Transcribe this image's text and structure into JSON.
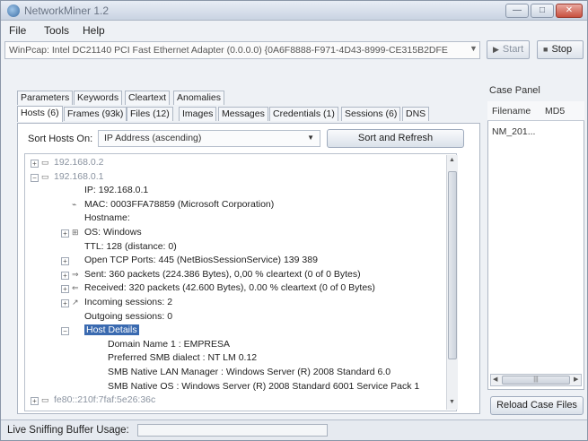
{
  "window": {
    "title": "NetworkMiner 1.2",
    "buttons": {
      "minimize": "—",
      "maximize": "□",
      "close": "✕"
    }
  },
  "menu": [
    "File",
    "Tools",
    "Help"
  ],
  "toolbar": {
    "interface": "WinPcap: Intel DC21140 PCI Fast Ethernet Adapter (0.0.0.0) {0A6F8888-F971-4D43-8999-CE315B2DFE",
    "start_label": "Start",
    "stop_label": "Stop"
  },
  "tabs": {
    "row1": [
      "Parameters",
      "Keywords",
      "Cleartext",
      "Anomalies"
    ],
    "row2": [
      "Hosts (6)",
      "Frames (93k)",
      "Files (12)",
      "Images",
      "Messages",
      "Credentials (1)",
      "Sessions (6)",
      "DNS"
    ],
    "active": "Hosts (6)"
  },
  "sort": {
    "label": "Sort Hosts On:",
    "selected": "IP Address (ascending)",
    "button": "Sort and Refresh"
  },
  "tree": [
    {
      "text": "192.168.0.2",
      "level": 0,
      "expander": "+",
      "icon": "host",
      "dim": true
    },
    {
      "text": "192.168.0.1",
      "level": 0,
      "expander": "−",
      "icon": "host",
      "dim": true
    },
    {
      "text": "IP: 192.168.0.1",
      "level": 1,
      "expander": "",
      "icon": ""
    },
    {
      "text": "MAC: 0003FFA78859 (Microsoft Corporation)",
      "level": 1,
      "expander": "",
      "icon": "nic"
    },
    {
      "text": "Hostname:",
      "level": 1,
      "expander": "",
      "icon": ""
    },
    {
      "text": "OS: Windows",
      "level": 1,
      "expander": "+",
      "icon": "os"
    },
    {
      "text": "TTL: 128 (distance: 0)",
      "level": 1,
      "expander": "",
      "icon": ""
    },
    {
      "text": "Open TCP Ports: 445 (NetBiosSessionService) 139 389",
      "level": 1,
      "expander": "+",
      "icon": ""
    },
    {
      "text": "Sent: 360 packets (224.386 Bytes), 0,00 % cleartext (0 of 0 Bytes)",
      "level": 1,
      "expander": "+",
      "icon": "sent"
    },
    {
      "text": "Received: 320 packets (42.600 Bytes), 0.00 % cleartext (0 of 0 Bytes)",
      "level": 1,
      "expander": "+",
      "icon": "recv"
    },
    {
      "text": "Incoming sessions: 2",
      "level": 1,
      "expander": "+",
      "icon": "in"
    },
    {
      "text": "Outgoing sessions: 0",
      "level": 1,
      "expander": "",
      "icon": ""
    },
    {
      "text": "Host Details",
      "level": 1,
      "expander": "−",
      "icon": "",
      "selected": true
    },
    {
      "text": "Domain Name 1 : EMPRESA",
      "level": 2,
      "expander": "",
      "icon": ""
    },
    {
      "text": "Preferred SMB dialect : NT LM 0.12",
      "level": 2,
      "expander": "",
      "icon": ""
    },
    {
      "text": "SMB Native LAN Manager : Windows Server (R) 2008 Standard 6.0",
      "level": 2,
      "expander": "",
      "icon": ""
    },
    {
      "text": "SMB Native OS : Windows Server (R) 2008 Standard 6001 Service Pack 1",
      "level": 2,
      "expander": "",
      "icon": ""
    },
    {
      "text": "fe80::210f:7faf:5e26:36c",
      "level": 0,
      "expander": "+",
      "icon": "host",
      "dim": true
    }
  ],
  "case_panel": {
    "label": "Case Panel",
    "columns": [
      "Filename",
      "MD5"
    ],
    "rows": [
      [
        "NM_201...",
        ""
      ]
    ],
    "reload_button": "Reload Case Files"
  },
  "status": {
    "label": "Live Sniffing Buffer Usage:",
    "buffer_usage": 0.0
  },
  "icons": {
    "host": "monitor-icon",
    "nic": "network-card-icon",
    "os": "os-icon",
    "sent": "arrow-right-icon",
    "recv": "arrow-left-icon",
    "in": "session-icon"
  }
}
